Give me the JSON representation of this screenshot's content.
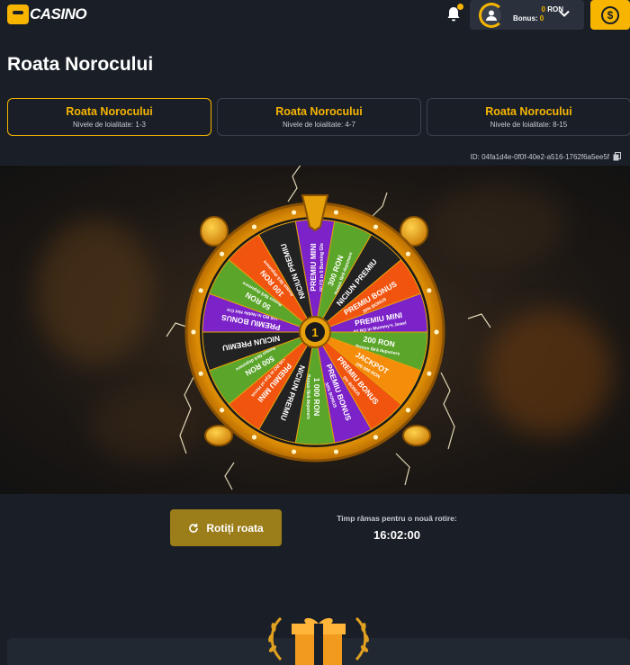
{
  "brand": {
    "logo_text": "CASINO",
    "accent": "#f7b500"
  },
  "account": {
    "balance_amount": "0",
    "balance_currency": "RON",
    "bonus_label": "Bonus:",
    "bonus_amount": "0"
  },
  "page": {
    "title": "Roata Norocului"
  },
  "tabs": [
    {
      "label": "Roata Norocului",
      "sub": "Nivele de loialitate: 1-3",
      "active": true
    },
    {
      "label": "Roata Norocului",
      "sub": "Nivele de loialitate: 4-7",
      "active": false
    },
    {
      "label": "Roata Norocului",
      "sub": "Nivele de loialitate: 8-15",
      "active": false
    }
  ],
  "wheel_id": "ID: 04fa1d4e-0f0f-40e2-a516-1762f6a5ee5f",
  "wheel": {
    "center_label": "1",
    "segments": [
      {
        "title": "PREMIU MINI",
        "sub": "50 FS in 5 Burning Glo",
        "color": "#7b22c8"
      },
      {
        "title": "300 RON",
        "sub": "Bonus fără depunere",
        "color": "#5aa52a"
      },
      {
        "title": "NICIUN PREMIU",
        "sub": "",
        "color": "#222222"
      },
      {
        "title": "PREMIU BONUS",
        "sub": "30% BONUS",
        "color": "#f0540f"
      },
      {
        "title": "PREMIU MINI",
        "sub": "50 RO in Mummy's Jewel",
        "color": "#7b22c8"
      },
      {
        "title": "200 RON",
        "sub": "Bonus fără depunere",
        "color": "#5aa52a"
      },
      {
        "title": "JACKPOT",
        "sub": "100 000 RON",
        "color": "#f58c0a"
      },
      {
        "title": "PREMIU BONUS",
        "sub": "5% BONUS",
        "color": "#f0540f"
      },
      {
        "title": "PREMIU BONUS",
        "sub": "50% BONUS",
        "color": "#7b22c8"
      },
      {
        "title": "1 000 RON",
        "sub": "Bonus fără depunere",
        "color": "#5aa52a"
      },
      {
        "title": "NICIUN PREMIU",
        "sub": "",
        "color": "#222222"
      },
      {
        "title": "PREMIU MINI",
        "sub": "100 RO in Eye of Horus",
        "color": "#f0540f"
      },
      {
        "title": "500 RON",
        "sub": "Bonus fără depunere",
        "color": "#5aa52a"
      },
      {
        "title": "NICIUN PREMIU",
        "sub": "",
        "color": "#222222"
      },
      {
        "title": "PREMIU BONUS",
        "sub": "100 RO in Noble Hot Cre",
        "color": "#7b22c8"
      },
      {
        "title": "50 RON",
        "sub": "Bonus fără depunere",
        "color": "#5aa52a"
      },
      {
        "title": "100 RON",
        "sub": "Bonus fără depunere",
        "color": "#f0540f"
      },
      {
        "title": "NICIUN PREMIU",
        "sub": "",
        "color": "#222222"
      }
    ]
  },
  "controls": {
    "spin_label": "Rotiți roata",
    "timer_label": "Timp rămas pentru o nouă rotire:",
    "timer_value": "16:02:00"
  }
}
